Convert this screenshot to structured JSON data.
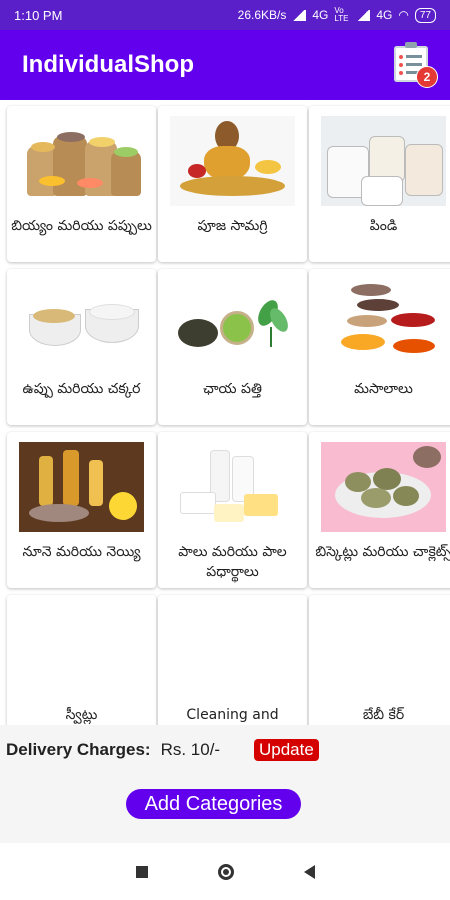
{
  "status": {
    "time": "1:10 PM",
    "speed": "26.6KB/s",
    "net1": "4G",
    "volte": "Vo LTE",
    "net2": "4G",
    "battery": "77"
  },
  "app": {
    "title": "IndividualShop",
    "cart_count": "2"
  },
  "categories": [
    {
      "label": "బియ్యం మరియు పప్పులు",
      "icon": "grains-sacks-image"
    },
    {
      "label": "పూజ సామగ్రి",
      "icon": "pooja-items-image"
    },
    {
      "label": "పిండి",
      "icon": "flour-jars-image"
    },
    {
      "label": "ఉప్పు మరియు చక్కర",
      "icon": "salt-sugar-image"
    },
    {
      "label": "ఛాయ పత్తి",
      "icon": "tea-leaves-image"
    },
    {
      "label": "మసాలాలు",
      "icon": "spice-spoons-image"
    },
    {
      "label": "నూనె మరియు నెయ్యి",
      "icon": "oil-ghee-image"
    },
    {
      "label": "పాలు మరియు పాల పధార్థాలు",
      "icon": "dairy-products-image"
    },
    {
      "label": "బిస్కెట్లు మరియు చాక్లెట్స్",
      "icon": "biscuits-image"
    },
    {
      "label": "స్వీట్లు",
      "icon": ""
    },
    {
      "label": "Cleaning and",
      "icon": ""
    },
    {
      "label": "బేబీ కేర్",
      "icon": ""
    }
  ],
  "delivery": {
    "label": "Delivery Charges:",
    "value": "Rs. 10/-",
    "update_label": "Update"
  },
  "add_categories_label": "Add Categories",
  "colors": {
    "primary": "#6200ee",
    "status_bar": "#5b1fc9",
    "update": "#d50000",
    "badge": "#e53935"
  }
}
